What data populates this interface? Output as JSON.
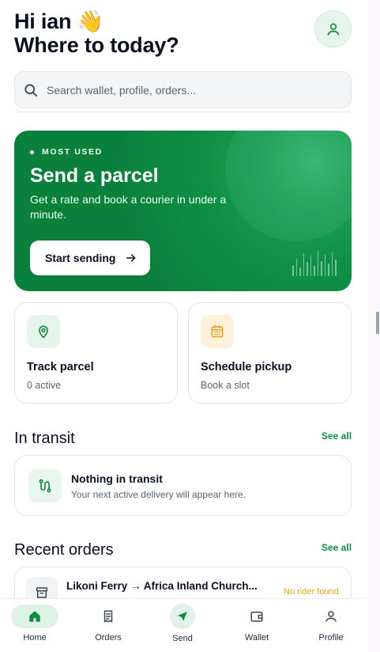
{
  "header": {
    "greeting": "Hi ian 👋",
    "subtitle": "Where to today?"
  },
  "search": {
    "placeholder": "Search wallet, profile, orders..."
  },
  "hero": {
    "tag": "MOST USED",
    "title": "Send a parcel",
    "description": "Get a rate and book a courier in under a minute.",
    "cta_label": "Start sending",
    "bar_levels": [
      0.45,
      0.7,
      0.35,
      0.9,
      0.55,
      0.8,
      0.4,
      1.0,
      0.6,
      0.85,
      0.5,
      0.95,
      0.65
    ]
  },
  "quick_actions": [
    {
      "title": "Track parcel",
      "subtitle": "0 active",
      "icon": "map-pin-icon"
    },
    {
      "title": "Schedule pickup",
      "subtitle": "Book a slot",
      "icon": "calendar-icon"
    }
  ],
  "in_transit": {
    "heading": "In transit",
    "see_all": "See all",
    "empty_title": "Nothing in transit",
    "empty_subtitle": "Your next active delivery will appear here."
  },
  "recent_orders": {
    "heading": "Recent orders",
    "see_all": "See all",
    "items": [
      {
        "route": "Likoni Ferry → Africa Inland Church...",
        "status": "No rider found"
      }
    ]
  },
  "tabbar": {
    "items": [
      {
        "label": "Home",
        "icon": "home-icon",
        "active": true
      },
      {
        "label": "Orders",
        "icon": "receipt-icon",
        "active": false
      },
      {
        "label": "Send",
        "icon": "send-icon",
        "active": false
      },
      {
        "label": "Wallet",
        "icon": "wallet-icon",
        "active": false
      },
      {
        "label": "Profile",
        "icon": "user-icon",
        "active": false
      }
    ]
  },
  "colors": {
    "brand": "#128a43",
    "brand_light": "#e6f5ec",
    "warning": "#e6a21a",
    "text": "#0b1020",
    "muted": "#5b6472"
  }
}
